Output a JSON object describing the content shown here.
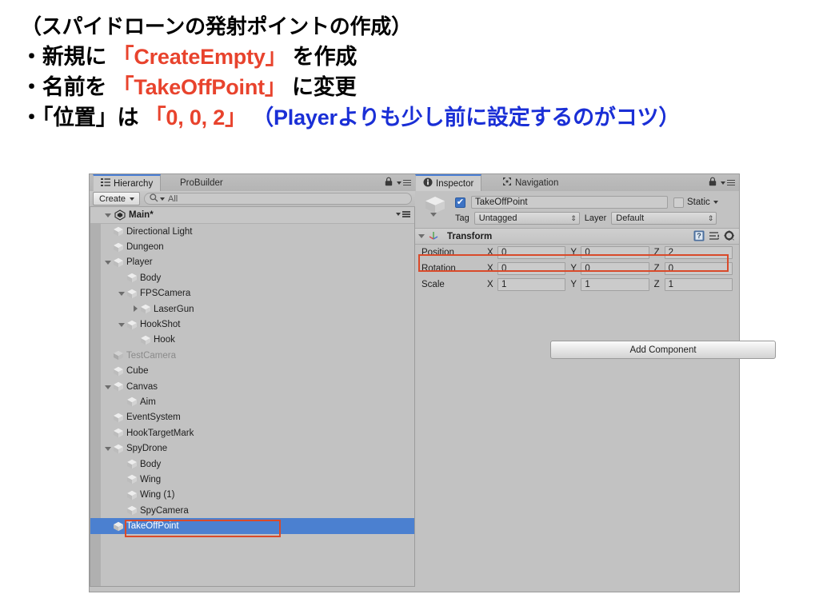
{
  "slide": {
    "line1": "（スパイドローンの発射ポイントの作成）",
    "line2": {
      "bullet": "・",
      "pre": "新規に ",
      "highlight": "「CreateEmpty」",
      "post": " を作成"
    },
    "line3": {
      "bullet": "・",
      "pre": "名前を ",
      "highlight": "「TakeOffPoint」",
      "post": " に変更"
    },
    "line4": {
      "bullet": "・",
      "pre": "「位置」は ",
      "highlight": "「0, 0, 2」",
      "post": " （Playerよりも少し前に設定するのがコツ）"
    }
  },
  "colors": {
    "highlight_red": "#e8432d",
    "highlight_blue": "#1a2fd6",
    "annotation_red": "#d94a2a",
    "selection_blue": "#4b80d0",
    "panel_gray": "#c2c2c2"
  },
  "hierarchy": {
    "tabs": [
      {
        "label": "Hierarchy",
        "icon": "list-icon",
        "active": true
      },
      {
        "label": "ProBuilder",
        "icon": "none",
        "active": false
      }
    ],
    "lock_icon": "lock-icon",
    "menu_icon": "menu-icon",
    "toolbar": {
      "create_label": "Create",
      "create_caret": "▾",
      "search_icon": "search-icon",
      "search_value": "All",
      "search_placeholder": "All"
    },
    "scene": {
      "label": "Main*",
      "icon": "unity-scene-icon",
      "expanded": true
    },
    "items": [
      {
        "label": "Directional Light",
        "depth": 1,
        "foldout": "none",
        "selected": false,
        "disabled": false
      },
      {
        "label": "Dungeon",
        "depth": 1,
        "foldout": "none",
        "selected": false,
        "disabled": false
      },
      {
        "label": "Player",
        "depth": 1,
        "foldout": "open",
        "selected": false,
        "disabled": false
      },
      {
        "label": "Body",
        "depth": 2,
        "foldout": "none",
        "selected": false,
        "disabled": false
      },
      {
        "label": "FPSCamera",
        "depth": 2,
        "foldout": "open",
        "selected": false,
        "disabled": false
      },
      {
        "label": "LaserGun",
        "depth": 3,
        "foldout": "closed",
        "selected": false,
        "disabled": false
      },
      {
        "label": "HookShot",
        "depth": 2,
        "foldout": "open",
        "selected": false,
        "disabled": false
      },
      {
        "label": "Hook",
        "depth": 3,
        "foldout": "none",
        "selected": false,
        "disabled": false
      },
      {
        "label": "TestCamera",
        "depth": 1,
        "foldout": "none",
        "selected": false,
        "disabled": true
      },
      {
        "label": "Cube",
        "depth": 1,
        "foldout": "none",
        "selected": false,
        "disabled": false
      },
      {
        "label": "Canvas",
        "depth": 1,
        "foldout": "open",
        "selected": false,
        "disabled": false
      },
      {
        "label": "Aim",
        "depth": 2,
        "foldout": "none",
        "selected": false,
        "disabled": false
      },
      {
        "label": "EventSystem",
        "depth": 1,
        "foldout": "none",
        "selected": false,
        "disabled": false
      },
      {
        "label": "HookTargetMark",
        "depth": 1,
        "foldout": "none",
        "selected": false,
        "disabled": false
      },
      {
        "label": "SpyDrone",
        "depth": 1,
        "foldout": "open",
        "selected": false,
        "disabled": false
      },
      {
        "label": "Body",
        "depth": 2,
        "foldout": "none",
        "selected": false,
        "disabled": false
      },
      {
        "label": "Wing",
        "depth": 2,
        "foldout": "none",
        "selected": false,
        "disabled": false
      },
      {
        "label": "Wing (1)",
        "depth": 2,
        "foldout": "none",
        "selected": false,
        "disabled": false
      },
      {
        "label": "SpyCamera",
        "depth": 2,
        "foldout": "none",
        "selected": false,
        "disabled": false
      },
      {
        "label": "TakeOffPoint",
        "depth": 1,
        "foldout": "none",
        "selected": true,
        "disabled": false
      }
    ]
  },
  "inspector": {
    "tabs": [
      {
        "label": "Inspector",
        "icon": "info-icon",
        "active": true
      },
      {
        "label": "Navigation",
        "icon": "navigation-icon",
        "active": false
      }
    ],
    "lock_icon": "lock-icon",
    "menu_icon": "menu-icon",
    "object": {
      "enabled_checkbox": true,
      "checkmark": "✔",
      "name": "TakeOffPoint",
      "static_label": "Static",
      "static_checked": false,
      "static_caret": "▾",
      "tag_label": "Tag",
      "tag_value": "Untagged",
      "layer_label": "Layer",
      "layer_value": "Default",
      "stepper": "⇕"
    },
    "transform": {
      "title": "Transform",
      "expanded": true,
      "help_icon": "help-book-icon",
      "preset_icon": "preset-icon",
      "gear_icon": "gear-icon",
      "axes": [
        "X",
        "Y",
        "Z"
      ],
      "rows": [
        {
          "label": "Position",
          "values": [
            "0",
            "0",
            "2"
          ],
          "annotated": true
        },
        {
          "label": "Rotation",
          "values": [
            "0",
            "0",
            "0"
          ],
          "annotated": false
        },
        {
          "label": "Scale",
          "values": [
            "1",
            "1",
            "1"
          ],
          "annotated": false
        }
      ]
    },
    "add_component_label": "Add Component"
  }
}
